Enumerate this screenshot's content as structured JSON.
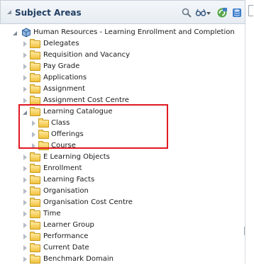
{
  "header": {
    "title": "Subject Areas",
    "icons": [
      "search-icon",
      "glasses-icon",
      "dropdown-arrow-icon",
      "refresh-icon",
      "database-icon"
    ]
  },
  "tree": {
    "root": {
      "label": "Human Resources - Learning Enrollment and Completion",
      "expanded": true
    },
    "items": [
      {
        "label": "Delegates",
        "level": 1,
        "expanded": false
      },
      {
        "label": "Requisition and Vacancy",
        "level": 1,
        "expanded": false
      },
      {
        "label": "Pay Grade",
        "level": 1,
        "expanded": false
      },
      {
        "label": "Applications",
        "level": 1,
        "expanded": false
      },
      {
        "label": "Assignment",
        "level": 1,
        "expanded": false
      },
      {
        "label": "Assignment Cost Centre",
        "level": 1,
        "expanded": false
      },
      {
        "label": "Learning Catalogue",
        "level": 1,
        "expanded": true
      },
      {
        "label": "Class",
        "level": 2,
        "expanded": false
      },
      {
        "label": "Offerings",
        "level": 2,
        "expanded": false
      },
      {
        "label": "Course",
        "level": 2,
        "expanded": false
      },
      {
        "label": "E Learning Objects",
        "level": 1,
        "expanded": false
      },
      {
        "label": "Enrollment",
        "level": 1,
        "expanded": false
      },
      {
        "label": "Learning Facts",
        "level": 1,
        "expanded": false
      },
      {
        "label": "Organisation",
        "level": 1,
        "expanded": false
      },
      {
        "label": "Organisation Cost Centre",
        "level": 1,
        "expanded": false
      },
      {
        "label": "Time",
        "level": 1,
        "expanded": false
      },
      {
        "label": "Learner Group",
        "level": 1,
        "expanded": false
      },
      {
        "label": "Performance",
        "level": 1,
        "expanded": false
      },
      {
        "label": "Current Date",
        "level": 1,
        "expanded": false
      },
      {
        "label": "Benchmark Domain",
        "level": 1,
        "expanded": false
      }
    ]
  },
  "colors": {
    "highlight": "#e01922",
    "title": "#223e63",
    "folder": "#f0c23c"
  }
}
